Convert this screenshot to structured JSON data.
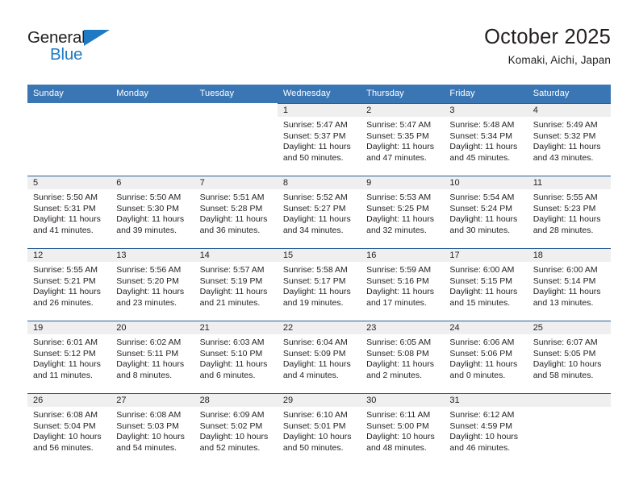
{
  "brand": {
    "name_top": "General",
    "name_bottom": "Blue",
    "accent_color": "#1f7ac4"
  },
  "header": {
    "title": "October 2025",
    "subtitle": "Komaki, Aichi, Japan"
  },
  "theme": {
    "header_bar_color": "#3b76b4",
    "daynum_band_color": "#efefef",
    "cell_rule_color": "#2b5f94",
    "text_color": "#231f20"
  },
  "weekday_headers": [
    "Sunday",
    "Monday",
    "Tuesday",
    "Wednesday",
    "Thursday",
    "Friday",
    "Saturday"
  ],
  "weeks": [
    [
      {
        "day": "",
        "empty": true,
        "sunrise": "",
        "sunset": "",
        "daylight1": "",
        "daylight2": ""
      },
      {
        "day": "",
        "empty": true,
        "sunrise": "",
        "sunset": "",
        "daylight1": "",
        "daylight2": ""
      },
      {
        "day": "",
        "empty": true,
        "sunrise": "",
        "sunset": "",
        "daylight1": "",
        "daylight2": ""
      },
      {
        "day": "1",
        "empty": false,
        "sunrise": "Sunrise: 5:47 AM",
        "sunset": "Sunset: 5:37 PM",
        "daylight1": "Daylight: 11 hours",
        "daylight2": "and 50 minutes."
      },
      {
        "day": "2",
        "empty": false,
        "sunrise": "Sunrise: 5:47 AM",
        "sunset": "Sunset: 5:35 PM",
        "daylight1": "Daylight: 11 hours",
        "daylight2": "and 47 minutes."
      },
      {
        "day": "3",
        "empty": false,
        "sunrise": "Sunrise: 5:48 AM",
        "sunset": "Sunset: 5:34 PM",
        "daylight1": "Daylight: 11 hours",
        "daylight2": "and 45 minutes."
      },
      {
        "day": "4",
        "empty": false,
        "sunrise": "Sunrise: 5:49 AM",
        "sunset": "Sunset: 5:32 PM",
        "daylight1": "Daylight: 11 hours",
        "daylight2": "and 43 minutes."
      }
    ],
    [
      {
        "day": "5",
        "empty": false,
        "sunrise": "Sunrise: 5:50 AM",
        "sunset": "Sunset: 5:31 PM",
        "daylight1": "Daylight: 11 hours",
        "daylight2": "and 41 minutes."
      },
      {
        "day": "6",
        "empty": false,
        "sunrise": "Sunrise: 5:50 AM",
        "sunset": "Sunset: 5:30 PM",
        "daylight1": "Daylight: 11 hours",
        "daylight2": "and 39 minutes."
      },
      {
        "day": "7",
        "empty": false,
        "sunrise": "Sunrise: 5:51 AM",
        "sunset": "Sunset: 5:28 PM",
        "daylight1": "Daylight: 11 hours",
        "daylight2": "and 36 minutes."
      },
      {
        "day": "8",
        "empty": false,
        "sunrise": "Sunrise: 5:52 AM",
        "sunset": "Sunset: 5:27 PM",
        "daylight1": "Daylight: 11 hours",
        "daylight2": "and 34 minutes."
      },
      {
        "day": "9",
        "empty": false,
        "sunrise": "Sunrise: 5:53 AM",
        "sunset": "Sunset: 5:25 PM",
        "daylight1": "Daylight: 11 hours",
        "daylight2": "and 32 minutes."
      },
      {
        "day": "10",
        "empty": false,
        "sunrise": "Sunrise: 5:54 AM",
        "sunset": "Sunset: 5:24 PM",
        "daylight1": "Daylight: 11 hours",
        "daylight2": "and 30 minutes."
      },
      {
        "day": "11",
        "empty": false,
        "sunrise": "Sunrise: 5:55 AM",
        "sunset": "Sunset: 5:23 PM",
        "daylight1": "Daylight: 11 hours",
        "daylight2": "and 28 minutes."
      }
    ],
    [
      {
        "day": "12",
        "empty": false,
        "sunrise": "Sunrise: 5:55 AM",
        "sunset": "Sunset: 5:21 PM",
        "daylight1": "Daylight: 11 hours",
        "daylight2": "and 26 minutes."
      },
      {
        "day": "13",
        "empty": false,
        "sunrise": "Sunrise: 5:56 AM",
        "sunset": "Sunset: 5:20 PM",
        "daylight1": "Daylight: 11 hours",
        "daylight2": "and 23 minutes."
      },
      {
        "day": "14",
        "empty": false,
        "sunrise": "Sunrise: 5:57 AM",
        "sunset": "Sunset: 5:19 PM",
        "daylight1": "Daylight: 11 hours",
        "daylight2": "and 21 minutes."
      },
      {
        "day": "15",
        "empty": false,
        "sunrise": "Sunrise: 5:58 AM",
        "sunset": "Sunset: 5:17 PM",
        "daylight1": "Daylight: 11 hours",
        "daylight2": "and 19 minutes."
      },
      {
        "day": "16",
        "empty": false,
        "sunrise": "Sunrise: 5:59 AM",
        "sunset": "Sunset: 5:16 PM",
        "daylight1": "Daylight: 11 hours",
        "daylight2": "and 17 minutes."
      },
      {
        "day": "17",
        "empty": false,
        "sunrise": "Sunrise: 6:00 AM",
        "sunset": "Sunset: 5:15 PM",
        "daylight1": "Daylight: 11 hours",
        "daylight2": "and 15 minutes."
      },
      {
        "day": "18",
        "empty": false,
        "sunrise": "Sunrise: 6:00 AM",
        "sunset": "Sunset: 5:14 PM",
        "daylight1": "Daylight: 11 hours",
        "daylight2": "and 13 minutes."
      }
    ],
    [
      {
        "day": "19",
        "empty": false,
        "sunrise": "Sunrise: 6:01 AM",
        "sunset": "Sunset: 5:12 PM",
        "daylight1": "Daylight: 11 hours",
        "daylight2": "and 11 minutes."
      },
      {
        "day": "20",
        "empty": false,
        "sunrise": "Sunrise: 6:02 AM",
        "sunset": "Sunset: 5:11 PM",
        "daylight1": "Daylight: 11 hours",
        "daylight2": "and 8 minutes."
      },
      {
        "day": "21",
        "empty": false,
        "sunrise": "Sunrise: 6:03 AM",
        "sunset": "Sunset: 5:10 PM",
        "daylight1": "Daylight: 11 hours",
        "daylight2": "and 6 minutes."
      },
      {
        "day": "22",
        "empty": false,
        "sunrise": "Sunrise: 6:04 AM",
        "sunset": "Sunset: 5:09 PM",
        "daylight1": "Daylight: 11 hours",
        "daylight2": "and 4 minutes."
      },
      {
        "day": "23",
        "empty": false,
        "sunrise": "Sunrise: 6:05 AM",
        "sunset": "Sunset: 5:08 PM",
        "daylight1": "Daylight: 11 hours",
        "daylight2": "and 2 minutes."
      },
      {
        "day": "24",
        "empty": false,
        "sunrise": "Sunrise: 6:06 AM",
        "sunset": "Sunset: 5:06 PM",
        "daylight1": "Daylight: 11 hours",
        "daylight2": "and 0 minutes."
      },
      {
        "day": "25",
        "empty": false,
        "sunrise": "Sunrise: 6:07 AM",
        "sunset": "Sunset: 5:05 PM",
        "daylight1": "Daylight: 10 hours",
        "daylight2": "and 58 minutes."
      }
    ],
    [
      {
        "day": "26",
        "empty": false,
        "sunrise": "Sunrise: 6:08 AM",
        "sunset": "Sunset: 5:04 PM",
        "daylight1": "Daylight: 10 hours",
        "daylight2": "and 56 minutes."
      },
      {
        "day": "27",
        "empty": false,
        "sunrise": "Sunrise: 6:08 AM",
        "sunset": "Sunset: 5:03 PM",
        "daylight1": "Daylight: 10 hours",
        "daylight2": "and 54 minutes."
      },
      {
        "day": "28",
        "empty": false,
        "sunrise": "Sunrise: 6:09 AM",
        "sunset": "Sunset: 5:02 PM",
        "daylight1": "Daylight: 10 hours",
        "daylight2": "and 52 minutes."
      },
      {
        "day": "29",
        "empty": false,
        "sunrise": "Sunrise: 6:10 AM",
        "sunset": "Sunset: 5:01 PM",
        "daylight1": "Daylight: 10 hours",
        "daylight2": "and 50 minutes."
      },
      {
        "day": "30",
        "empty": false,
        "sunrise": "Sunrise: 6:11 AM",
        "sunset": "Sunset: 5:00 PM",
        "daylight1": "Daylight: 10 hours",
        "daylight2": "and 48 minutes."
      },
      {
        "day": "31",
        "empty": false,
        "sunrise": "Sunrise: 6:12 AM",
        "sunset": "Sunset: 4:59 PM",
        "daylight1": "Daylight: 10 hours",
        "daylight2": "and 46 minutes."
      },
      {
        "day": "",
        "empty": true,
        "sunrise": "",
        "sunset": "",
        "daylight1": "",
        "daylight2": ""
      }
    ]
  ]
}
